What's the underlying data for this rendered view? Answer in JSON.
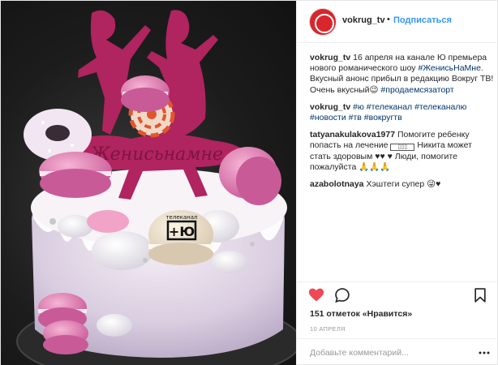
{
  "post": {
    "username": "vokrug_tv",
    "separator": "•",
    "follow_label": "Подписаться",
    "avatar_color": "#d8262c",
    "link_color": "#3897f0",
    "hashtag_color": "#003569"
  },
  "photo": {
    "topper_text": "Женисьнамне",
    "macaron_label_top": "телеканал",
    "macaron_label_main": "+Ю"
  },
  "comments": [
    {
      "user": "vokrug_tv",
      "parts": [
        {
          "t": "text",
          "v": " 16 апреля на канале Ю премьера нового романического шоу "
        },
        {
          "t": "tag",
          "v": "#ЖенисьНаМне"
        },
        {
          "t": "text",
          "v": ". Вкусный анонс прибыл в редакцию Вокруг ТВ! Очень вкусный😉 "
        },
        {
          "t": "tag",
          "v": "#продаемсязаторт"
        }
      ]
    },
    {
      "user": "vokrug_tv",
      "parts": [
        {
          "t": "text",
          "v": " "
        },
        {
          "t": "tag",
          "v": "#ю #телеканал #телеканалю #новости #тв #вокругтв"
        }
      ]
    },
    {
      "user": "tatyanakulakova1977",
      "parts": [
        {
          "t": "text",
          "v": " Помогите ребенку попасть на лечение "
        },
        {
          "t": "box",
          "v": "▯▯▯"
        },
        {
          "t": "text",
          "v": " Никита может стать здоровым ♥♥ ♥ Люди, помогите пожалуйста 🙏🙏🙏"
        }
      ]
    },
    {
      "user": "azabolotnaya",
      "parts": [
        {
          "t": "text",
          "v": " Хэштеги супер 😜♥"
        }
      ]
    }
  ],
  "actions": {
    "like_icon": "heart-icon",
    "comment_icon": "speech-bubble-icon",
    "save_icon": "bookmark-icon",
    "likes_text": "151 отметок «Нравится»",
    "date_text": "10 АПРЕЛЯ"
  },
  "add_comment": {
    "placeholder": "Добавьте комментарий...",
    "more_icon": "more-options-icon"
  }
}
